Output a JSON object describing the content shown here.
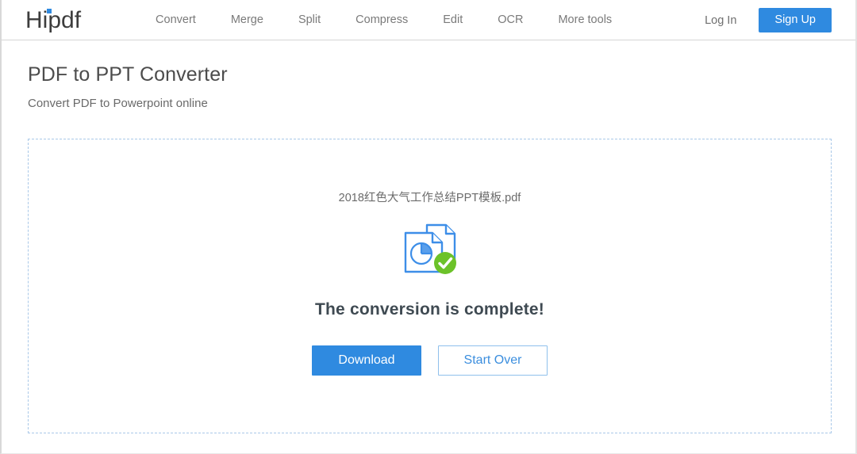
{
  "header": {
    "logo_text": "Hipdf",
    "logo_dot_color": "#2f8ae0",
    "nav": [
      {
        "label": "Convert"
      },
      {
        "label": "Merge"
      },
      {
        "label": "Split"
      },
      {
        "label": "Compress"
      },
      {
        "label": "Edit"
      },
      {
        "label": "OCR"
      },
      {
        "label": "More tools"
      }
    ],
    "login_label": "Log In",
    "signup_label": "Sign Up",
    "signup_bg": "#2f8ae0"
  },
  "main": {
    "title": "PDF to PPT Converter",
    "subtitle": "Convert PDF to Powerpoint online",
    "dropzone": {
      "filename": "2018红色大气工作总结PPT模板.pdf",
      "icon": "pdf-to-ppt-complete-icon",
      "status_text": "The conversion is complete!",
      "buttons": {
        "download_label": "Download",
        "startover_label": "Start Over"
      },
      "border_color": "#a9c8e8",
      "icon_colors": {
        "document": "#3d8ee8",
        "check_badge": "#6cc229"
      }
    }
  }
}
